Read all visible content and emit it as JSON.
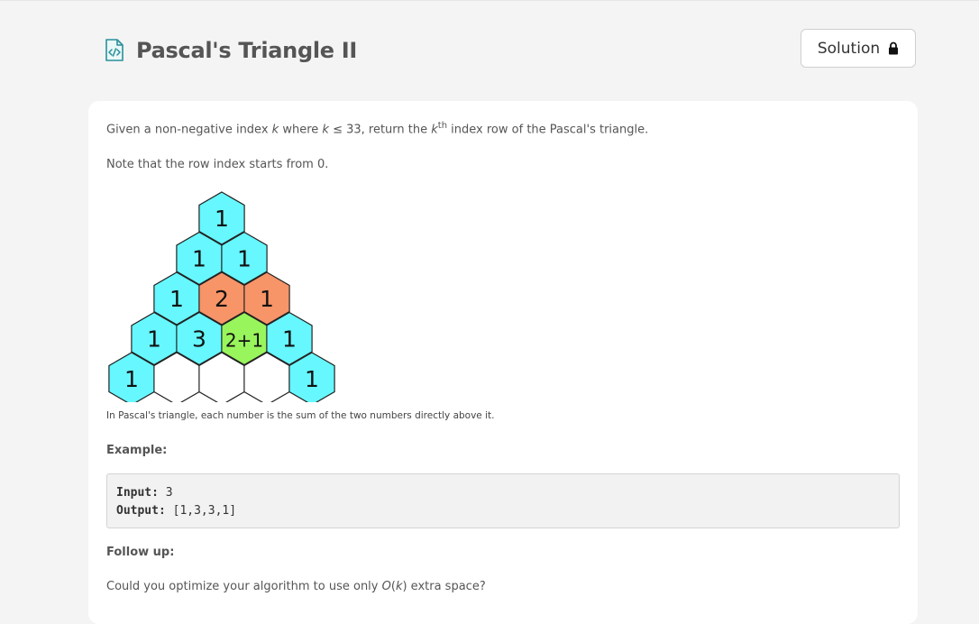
{
  "header": {
    "title": "Pascal's Triangle II",
    "icon": "code-file-icon",
    "solution_label": "Solution",
    "solution_icon": "lock-icon"
  },
  "description": {
    "p1_a": "Given a non-negative index ",
    "p1_k": "k",
    "p1_b": " where ",
    "p1_k2": "k",
    "p1_c": " ≤ 33, return the ",
    "p1_k3": "k",
    "p1_sup": "th",
    "p1_d": " index row of the Pascal's triangle.",
    "p2": "Note that the row index starts from 0."
  },
  "figure": {
    "rows": [
      [
        "1"
      ],
      [
        "1",
        "1"
      ],
      [
        "1",
        "2",
        "1"
      ],
      [
        "1",
        "3",
        "2+1",
        "1"
      ],
      [
        "1",
        "",
        "",
        "",
        "1"
      ]
    ],
    "colors": {
      "cyan": "#66f7ff",
      "orange": "#f79468",
      "green": "#99f55c",
      "white": "#ffffff"
    },
    "caption": "In Pascal's triangle, each number is the sum of the two numbers directly above it."
  },
  "example": {
    "label": "Example:",
    "input_key": "Input:",
    "input_value": " 3",
    "output_key": "Output:",
    "output_value": " [1,3,3,1]"
  },
  "followup": {
    "label": "Follow up:",
    "text_a": "Could you optimize your algorithm to use only ",
    "text_o": "O",
    "text_b": "(",
    "text_k": "k",
    "text_c": ")",
    "text_d": " extra space?"
  }
}
